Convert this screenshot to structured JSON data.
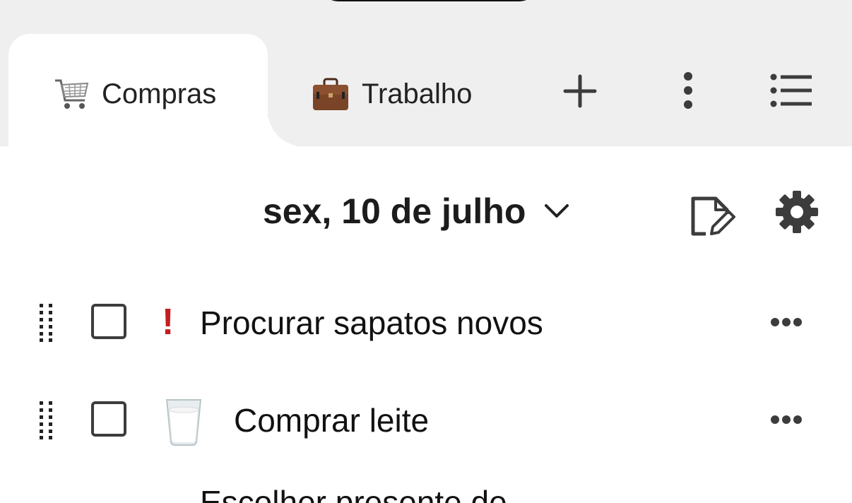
{
  "tabs": [
    {
      "label": "Compras",
      "icon": "shopping-cart-icon",
      "active": true
    },
    {
      "label": "Trabalho",
      "icon": "briefcase-icon",
      "active": false
    }
  ],
  "toolbar": {
    "add_icon": "plus-icon",
    "more_icon": "vertical-dots-icon",
    "lists_icon": "list-icon"
  },
  "header": {
    "date": "sex, 10 de julho",
    "date_icon": "chevron-down-icon",
    "edit_icon": "edit-note-icon",
    "settings_icon": "gear-icon"
  },
  "tasks": [
    {
      "title": "Procurar sapatos novos",
      "priority_mark": "!",
      "checked": false
    },
    {
      "title": "Comprar leite",
      "emoji": "milk-glass-icon",
      "checked": false
    },
    {
      "title": "Escolher presente de",
      "checked": false
    }
  ],
  "colors": {
    "tabbar_bg": "#efefef",
    "priority": "#c21e1e",
    "icon": "#3c3c3c"
  }
}
